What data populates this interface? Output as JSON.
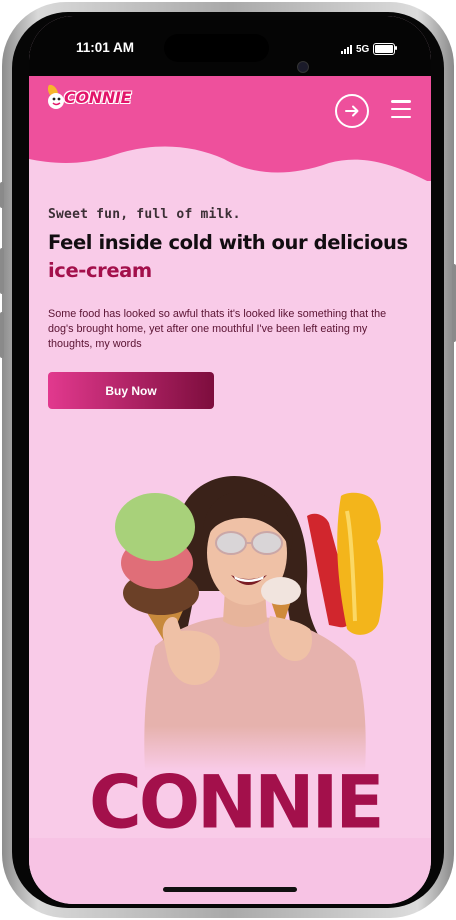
{
  "status_bar": {
    "time": "11:01 AM",
    "network": "5G"
  },
  "header": {
    "logo_text": "CONNIE"
  },
  "hero": {
    "tagline": "Sweet fun, full of milk.",
    "headline_main": "Feel inside cold with our delicious ",
    "headline_highlight": "ice-cream",
    "description": "Some food has looked so awful thats it's looked like something that the dog's brought home, yet after one mouthful I've been left eating my thoughts, my words",
    "cta_label": "Buy Now",
    "brand_word": "CONNIE"
  },
  "colors": {
    "navbar": "#ee509c",
    "background": "#f9cbe8",
    "accent": "#a3104b",
    "button_gradient": [
      "#e2398e",
      "#7d0d3d"
    ]
  },
  "icons": [
    "signal-icon",
    "battery-icon",
    "logo-icon",
    "arrow-right-icon",
    "menu-icon"
  ]
}
